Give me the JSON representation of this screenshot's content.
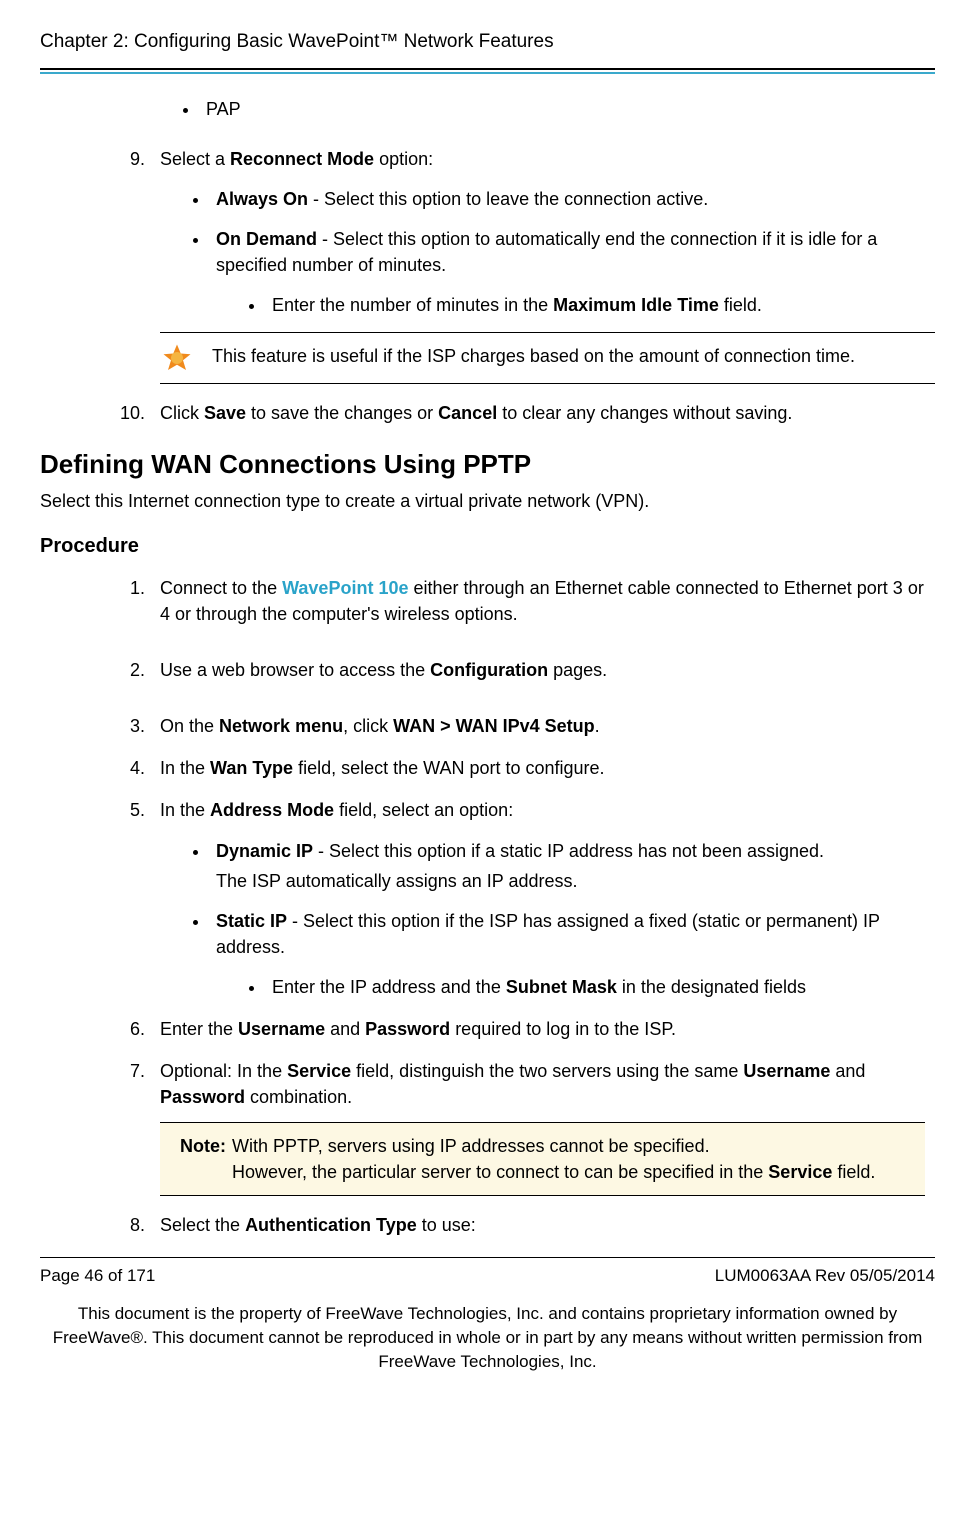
{
  "header": {
    "chapter": "Chapter 2: Configuring Basic WavePoint™ Network Features"
  },
  "sec1": {
    "bullet_pap": "PAP",
    "s9_pre": "Select a ",
    "s9_b1": "Reconnect Mode",
    "s9_post": " option:",
    "s9_i1_b": "Always On",
    "s9_i1_t": " - Select this option to leave the connection active.",
    "s9_i2_b": "On Demand",
    "s9_i2_t": " - Select this option to automatically end the connection if it is idle for a specified number of minutes.",
    "s9_i2_s_pre": "Enter the number of minutes in the ",
    "s9_i2_s_b": "Maximum Idle Time",
    "s9_i2_s_post": " field.",
    "tip": "This feature is useful if the ISP charges based on the amount of connection time.",
    "s10_p1": "Click ",
    "s10_b1": "Save",
    "s10_p2": " to save the changes or ",
    "s10_b2": "Cancel",
    "s10_p3": " to clear any changes without saving."
  },
  "sec2": {
    "heading": "Defining WAN Connections Using PPTP",
    "sub": "Select this Internet connection type to create a virtual private network (VPN).",
    "proc": "Procedure",
    "s1_p1": "Connect to the ",
    "s1_link": "WavePoint 10e",
    "s1_p2": " either through an Ethernet cable connected to Ethernet port 3 or 4 or through the computer's wireless options.",
    "s2_p1": "Use a web browser to access the ",
    "s2_b1": "Configuration",
    "s2_p2": " pages.",
    "s3_p1": "On the ",
    "s3_b1": "Network menu",
    "s3_p2": ", click ",
    "s3_b2": "WAN > WAN IPv4 Setup",
    "s3_p3": ".",
    "s4_p1": "In the ",
    "s4_b1": "Wan Type",
    "s4_p2": " field, select the WAN port to configure.",
    "s5_p1": "In the ",
    "s5_b1": "Address Mode",
    "s5_p2": " field, select an option:",
    "s5_i1_b": "Dynamic IP",
    "s5_i1_t": " - Select this option if a static IP address has not been assigned.",
    "s5_i1_sub": "The ISP automatically assigns an IP address.",
    "s5_i2_b": "Static IP",
    "s5_i2_t": " - Select this option if the ISP has assigned a fixed (static or permanent) IP address.",
    "s5_i2_s_p1": "Enter the IP address and the ",
    "s5_i2_s_b": "Subnet Mask",
    "s5_i2_s_p2": " in the designated fields",
    "s6_p1": "Enter the ",
    "s6_b1": "Username",
    "s6_p2": " and ",
    "s6_b2": "Password",
    "s6_p3": " required to log in to the ISP.",
    "s7_p1": "Optional: In the ",
    "s7_b1": "Service",
    "s7_p2": " field, distinguish the two servers using the same ",
    "s7_b2": "Username",
    "s7_p3": " and ",
    "s7_b3": "Password",
    "s7_p4": " combination.",
    "note_label": "Note:",
    "note_l1": "With PPTP, servers using IP addresses cannot be specified.",
    "note_l2_p1": "However, the particular server to connect to can be specified in the ",
    "note_l2_b": "Service",
    "note_l2_p2": " field.",
    "s8_p1": "Select the ",
    "s8_b1": "Authentication Type",
    "s8_p2": " to use:"
  },
  "footer": {
    "page": "Page 46 of 171",
    "rev": "LUM0063AA Rev 05/05/2014",
    "legal": "This document is the property of FreeWave Technologies, Inc. and contains proprietary information owned by FreeWave®. This document cannot be reproduced in whole or in part by any means without written permission from FreeWave Technologies, Inc."
  }
}
